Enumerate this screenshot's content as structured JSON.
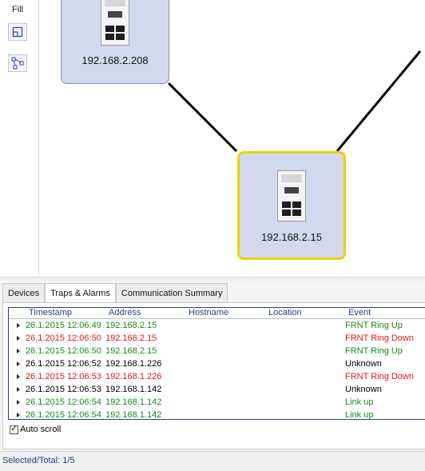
{
  "toolbar": {
    "fill_label": "Fill",
    "icons": [
      "fit-view-icon",
      "layout-tree-icon"
    ]
  },
  "topology": {
    "nodes": [
      {
        "id": "n1",
        "label": "192.168.2.208",
        "selected": false,
        "icon": "switch-device-icon"
      },
      {
        "id": "n2",
        "label": "192.168.2.15",
        "selected": true,
        "icon": "switch-device-icon"
      }
    ],
    "colors": {
      "node_fill": "#d3d9ed",
      "selection": "#f0d000",
      "link": "#000000"
    }
  },
  "tabs": [
    {
      "label": "Devices",
      "active": false
    },
    {
      "label": "Traps & Alarms",
      "active": true
    },
    {
      "label": "Communication Summary",
      "active": false
    }
  ],
  "table": {
    "columns": [
      "Timestamp",
      "Address",
      "Hostname",
      "Location",
      "Event"
    ],
    "rows": [
      {
        "timestamp": "26.1.2015 12:06:49",
        "address": "192.168.2.15",
        "hostname": "",
        "location": "",
        "event": "FRNT Ring Up",
        "color": "#1a8a1a"
      },
      {
        "timestamp": "26.1.2015 12:06:50",
        "address": "192.168.2.15",
        "hostname": "",
        "location": "",
        "event": "FRNT Ring Down",
        "color": "#e01818"
      },
      {
        "timestamp": "26.1.2015 12:06:50",
        "address": "192.168.2.15",
        "hostname": "",
        "location": "",
        "event": "FRNT Ring Up",
        "color": "#1a8a1a"
      },
      {
        "timestamp": "26.1.2015 12:06:52",
        "address": "192.168.1.226",
        "hostname": "",
        "location": "",
        "event": "Unknown",
        "color": "#000000"
      },
      {
        "timestamp": "26.1.2015 12:06:53",
        "address": "192.168.1.226",
        "hostname": "",
        "location": "",
        "event": "FRNT Ring Down",
        "color": "#e01818"
      },
      {
        "timestamp": "26.1.2015 12:06:53",
        "address": "192.168.1.142",
        "hostname": "",
        "location": "",
        "event": "Unknown",
        "color": "#000000"
      },
      {
        "timestamp": "26.1.2015 12:06:54",
        "address": "192.168.1.142",
        "hostname": "",
        "location": "",
        "event": "Link up",
        "color": "#1a8a1a"
      },
      {
        "timestamp": "26.1.2015 12:06:54",
        "address": "192.168.1.142",
        "hostname": "",
        "location": "",
        "event": "Link up",
        "color": "#1a8a1a"
      }
    ]
  },
  "auto_scroll": {
    "label": "Auto scroll",
    "checked": true
  },
  "status": {
    "text": "Selected/Total: 1/5"
  }
}
